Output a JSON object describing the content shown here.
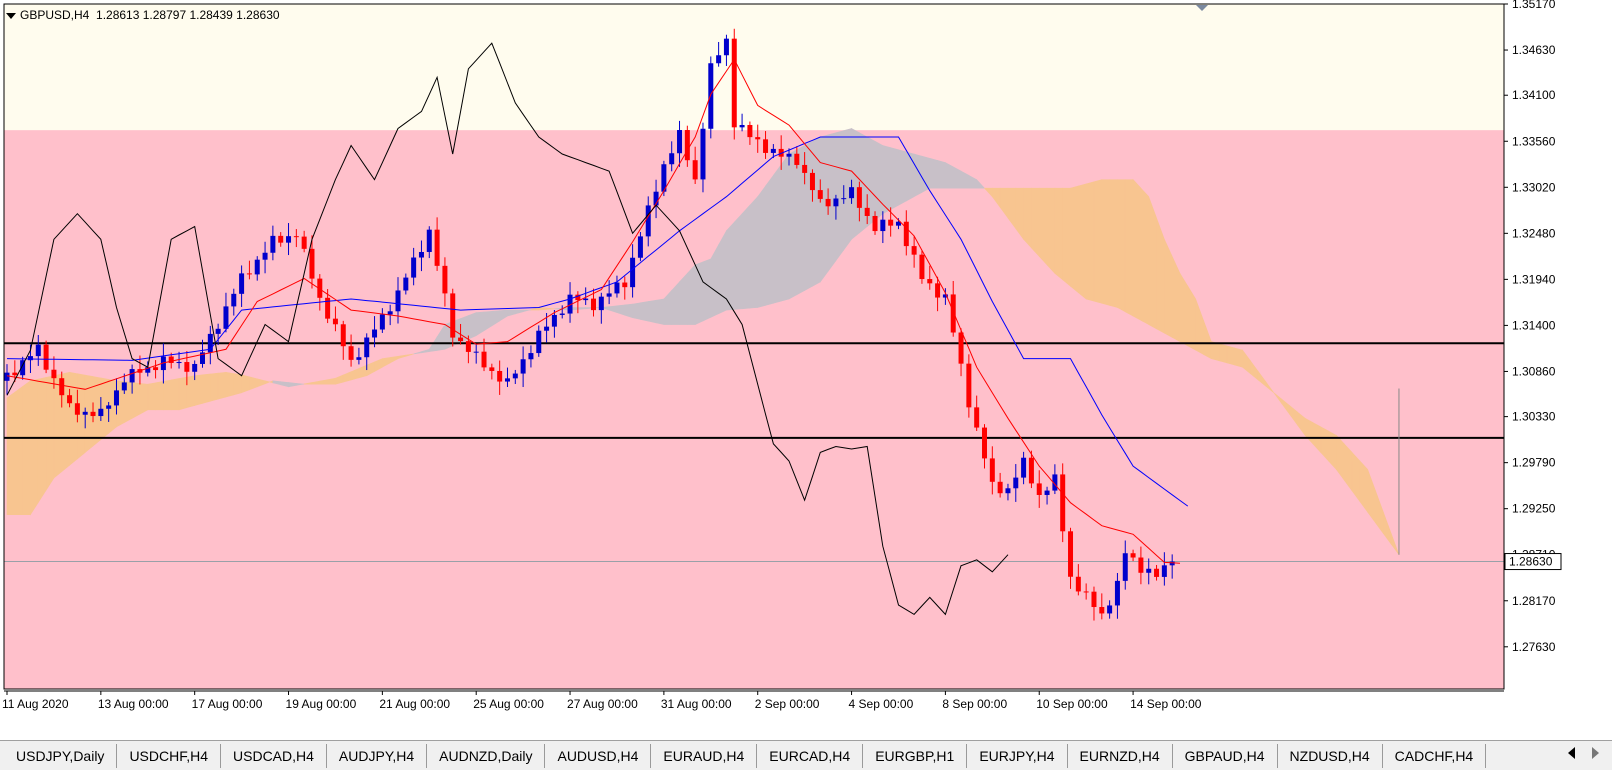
{
  "header": {
    "symbol": "GBPUSD,H4",
    "ohlc": "1.28613 1.28797 1.28439 1.28630"
  },
  "chart_data": {
    "type": "candlestick",
    "price_axis": [
      "1.35170",
      "1.34630",
      "1.34100",
      "1.33560",
      "1.33020",
      "1.32480",
      "1.31940",
      "1.31400",
      "1.30860",
      "1.30330",
      "1.29790",
      "1.29250",
      "1.28710",
      "1.28170",
      "1.27630"
    ],
    "current_price_label": "1.28630",
    "current_price": 1.2863,
    "time_axis": [
      {
        "label": "11 Aug 2020",
        "i": 0
      },
      {
        "label": "13 Aug 00:00",
        "i": 12
      },
      {
        "label": "17 Aug 00:00",
        "i": 24
      },
      {
        "label": "19 Aug 00:00",
        "i": 36
      },
      {
        "label": "21 Aug 00:00",
        "i": 48
      },
      {
        "label": "25 Aug 00:00",
        "i": 60
      },
      {
        "label": "27 Aug 00:00",
        "i": 72
      },
      {
        "label": "31 Aug 00:00",
        "i": 84
      },
      {
        "label": "2 Sep 00:00",
        "i": 96
      },
      {
        "label": "4 Sep 00:00",
        "i": 108
      },
      {
        "label": "8 Sep 00:00",
        "i": 120
      },
      {
        "label": "10 Sep 00:00",
        "i": 132
      },
      {
        "label": "14 Sep 00:00",
        "i": 144
      }
    ],
    "ylim": [
      1.27135,
      1.3517
    ],
    "pink_zone_top": 1.3369,
    "horizontal_lines": [
      1.3119,
      1.3008
    ],
    "vertical_line": {
      "i": 178,
      "from": 1.3066,
      "to": 1.2871
    },
    "colors": {
      "bull": "#0000cc",
      "bear": "#ff0000",
      "tenkan": "#ff0000",
      "kijun": "#0000ff",
      "chikou": "#000000",
      "cloud_bear": "#c8c0c8",
      "cloud_bull": "#f8c590",
      "background": "#fffcee",
      "zone": "#ffc0cb"
    },
    "anchors": {
      "close": [
        [
          0,
          1.3081
        ],
        [
          4,
          1.3112
        ],
        [
          8,
          1.3042
        ],
        [
          12,
          1.3035
        ],
        [
          15,
          1.3078
        ],
        [
          20,
          1.3098
        ],
        [
          24,
          1.3091
        ],
        [
          30,
          1.3195
        ],
        [
          34,
          1.3238
        ],
        [
          37,
          1.3248
        ],
        [
          40,
          1.3172
        ],
        [
          44,
          1.3098
        ],
        [
          46,
          1.3121
        ],
        [
          50,
          1.3178
        ],
        [
          54,
          1.3251
        ],
        [
          57,
          1.3131
        ],
        [
          60,
          1.3102
        ],
        [
          64,
          1.3071
        ],
        [
          68,
          1.3128
        ],
        [
          72,
          1.3172
        ],
        [
          75,
          1.3165
        ],
        [
          79,
          1.3191
        ],
        [
          84,
          1.3329
        ],
        [
          86,
          1.3362
        ],
        [
          88,
          1.3311
        ],
        [
          90,
          1.3441
        ],
        [
          92,
          1.3475
        ],
        [
          93,
          1.3379
        ],
        [
          95,
          1.3361
        ],
        [
          99,
          1.3338
        ],
        [
          101,
          1.3335
        ],
        [
          104,
          1.3282
        ],
        [
          108,
          1.3295
        ],
        [
          111,
          1.3255
        ],
        [
          114,
          1.3261
        ],
        [
          117,
          1.3195
        ],
        [
          120,
          1.3172
        ],
        [
          123,
          1.3051
        ],
        [
          126,
          1.2951
        ],
        [
          128,
          1.2948
        ],
        [
          130,
          1.2978
        ],
        [
          132,
          1.2941
        ],
        [
          134,
          1.2958
        ],
        [
          136,
          1.2845
        ],
        [
          138,
          1.2821
        ],
        [
          140,
          1.2801
        ],
        [
          142,
          1.2835
        ],
        [
          143,
          1.2873
        ],
        [
          145,
          1.2857
        ],
        [
          147,
          1.2845
        ],
        [
          149,
          1.2863
        ]
      ],
      "tenkan": [
        [
          0,
          1.3081
        ],
        [
          10,
          1.3065
        ],
        [
          20,
          1.3096
        ],
        [
          28,
          1.3112
        ],
        [
          32,
          1.3168
        ],
        [
          38,
          1.3195
        ],
        [
          44,
          1.3158
        ],
        [
          50,
          1.3151
        ],
        [
          56,
          1.3141
        ],
        [
          60,
          1.3118
        ],
        [
          64,
          1.3121
        ],
        [
          70,
          1.3155
        ],
        [
          76,
          1.3182
        ],
        [
          80,
          1.3238
        ],
        [
          84,
          1.3298
        ],
        [
          88,
          1.3361
        ],
        [
          90,
          1.3411
        ],
        [
          93,
          1.3452
        ],
        [
          96,
          1.3398
        ],
        [
          100,
          1.3375
        ],
        [
          104,
          1.3331
        ],
        [
          108,
          1.3321
        ],
        [
          112,
          1.3282
        ],
        [
          116,
          1.3245
        ],
        [
          120,
          1.3178
        ],
        [
          124,
          1.3091
        ],
        [
          128,
          1.3031
        ],
        [
          132,
          1.2975
        ],
        [
          136,
          1.2932
        ],
        [
          140,
          1.2905
        ],
        [
          144,
          1.2895
        ],
        [
          148,
          1.2862
        ],
        [
          150,
          1.2861
        ]
      ],
      "kijun": [
        [
          0,
          1.3101
        ],
        [
          16,
          1.3099
        ],
        [
          26,
          1.3112
        ],
        [
          30,
          1.3158
        ],
        [
          44,
          1.3171
        ],
        [
          58,
          1.3158
        ],
        [
          68,
          1.3161
        ],
        [
          72,
          1.3171
        ],
        [
          78,
          1.3191
        ],
        [
          86,
          1.3251
        ],
        [
          92,
          1.3291
        ],
        [
          98,
          1.3338
        ],
        [
          104,
          1.3361
        ],
        [
          114,
          1.3361
        ],
        [
          118,
          1.3298
        ],
        [
          122,
          1.3241
        ],
        [
          126,
          1.3168
        ],
        [
          130,
          1.3101
        ],
        [
          136,
          1.3101
        ],
        [
          140,
          1.3035
        ],
        [
          144,
          1.2975
        ],
        [
          148,
          1.2948
        ],
        [
          151,
          1.2928
        ]
      ],
      "chikou": [
        [
          0,
          1.3058
        ],
        [
          3,
          1.3111
        ],
        [
          6,
          1.3241
        ],
        [
          9,
          1.3271
        ],
        [
          12,
          1.3241
        ],
        [
          14,
          1.3161
        ],
        [
          16,
          1.3101
        ],
        [
          18,
          1.3091
        ],
        [
          21,
          1.3241
        ],
        [
          24,
          1.3256
        ],
        [
          27,
          1.3101
        ],
        [
          30,
          1.3081
        ],
        [
          33,
          1.3141
        ],
        [
          36,
          1.3121
        ],
        [
          39,
          1.3241
        ],
        [
          42,
          1.3311
        ],
        [
          44,
          1.3351
        ],
        [
          47,
          1.3311
        ],
        [
          50,
          1.3371
        ],
        [
          53,
          1.3391
        ],
        [
          55,
          1.3431
        ],
        [
          57,
          1.3341
        ],
        [
          59,
          1.3441
        ],
        [
          62,
          1.3471
        ],
        [
          65,
          1.3401
        ],
        [
          68,
          1.3361
        ],
        [
          71,
          1.3341
        ],
        [
          74,
          1.3331
        ],
        [
          77,
          1.3321
        ],
        [
          80,
          1.3248
        ],
        [
          83,
          1.3281
        ],
        [
          86,
          1.3251
        ],
        [
          89,
          1.3191
        ],
        [
          92,
          1.3171
        ],
        [
          94,
          1.3141
        ],
        [
          96,
          1.3071
        ],
        [
          98,
          1.3001
        ],
        [
          100,
          1.2981
        ],
        [
          102,
          1.2935
        ],
        [
          104,
          1.2991
        ],
        [
          106,
          1.2998
        ],
        [
          108,
          1.2995
        ],
        [
          110,
          1.2998
        ],
        [
          112,
          1.2881
        ],
        [
          114,
          1.2812
        ],
        [
          116,
          1.2801
        ],
        [
          118,
          1.2821
        ],
        [
          120,
          1.2801
        ],
        [
          122,
          1.2858
        ],
        [
          124,
          1.2865
        ],
        [
          126,
          1.2851
        ],
        [
          128,
          1.2871
        ]
      ],
      "span_a": [
        [
          0,
          1.3055
        ],
        [
          3,
          1.3075
        ],
        [
          8,
          1.3085
        ],
        [
          14,
          1.3075
        ],
        [
          18,
          1.3071
        ],
        [
          24,
          1.3081
        ],
        [
          28,
          1.3085
        ],
        [
          30,
          1.3082
        ],
        [
          36,
          1.3068
        ],
        [
          42,
          1.3078
        ],
        [
          48,
          1.3101
        ],
        [
          56,
          1.3112
        ],
        [
          60,
          1.3128
        ],
        [
          64,
          1.3151
        ],
        [
          68,
          1.3161
        ],
        [
          72,
          1.3158
        ],
        [
          76,
          1.3161
        ],
        [
          80,
          1.3149
        ],
        [
          84,
          1.3141
        ],
        [
          88,
          1.3141
        ],
        [
          92,
          1.3158
        ],
        [
          96,
          1.3161
        ],
        [
          100,
          1.3171
        ],
        [
          104,
          1.3191
        ],
        [
          108,
          1.3241
        ],
        [
          112,
          1.3271
        ],
        [
          116,
          1.3291
        ],
        [
          118,
          1.3301
        ],
        [
          120,
          1.3301
        ],
        [
          124,
          1.3301
        ],
        [
          128,
          1.3301
        ],
        [
          132,
          1.3301
        ],
        [
          136,
          1.3301
        ],
        [
          140,
          1.3311
        ],
        [
          144,
          1.3311
        ],
        [
          146,
          1.3291
        ],
        [
          148,
          1.3241
        ],
        [
          150,
          1.3201
        ],
        [
          152,
          1.3171
        ],
        [
          154,
          1.3121
        ],
        [
          158,
          1.3111
        ],
        [
          162,
          1.3061
        ],
        [
          166,
          1.3031
        ],
        [
          170,
          1.3011
        ],
        [
          174,
          1.2971
        ],
        [
          178,
          1.2871
        ]
      ],
      "span_b": [
        [
          0,
          1.2918
        ],
        [
          3,
          1.2918
        ],
        [
          6,
          1.2961
        ],
        [
          10,
          1.2991
        ],
        [
          14,
          1.3021
        ],
        [
          18,
          1.3041
        ],
        [
          22,
          1.3041
        ],
        [
          26,
          1.3051
        ],
        [
          30,
          1.3061
        ],
        [
          34,
          1.3075
        ],
        [
          38,
          1.3071
        ],
        [
          42,
          1.3071
        ],
        [
          46,
          1.3081
        ],
        [
          50,
          1.3101
        ],
        [
          54,
          1.3112
        ],
        [
          56,
          1.3141
        ],
        [
          60,
          1.3155
        ],
        [
          64,
          1.3158
        ],
        [
          68,
          1.3158
        ],
        [
          72,
          1.3161
        ],
        [
          76,
          1.3161
        ],
        [
          80,
          1.3165
        ],
        [
          84,
          1.3171
        ],
        [
          88,
          1.3211
        ],
        [
          90,
          1.3218
        ],
        [
          92,
          1.3251
        ],
        [
          96,
          1.3291
        ],
        [
          100,
          1.3341
        ],
        [
          104,
          1.3361
        ],
        [
          108,
          1.3371
        ],
        [
          112,
          1.3351
        ],
        [
          116,
          1.3341
        ],
        [
          120,
          1.3331
        ],
        [
          124,
          1.3311
        ],
        [
          126,
          1.3291
        ],
        [
          130,
          1.3241
        ],
        [
          134,
          1.3201
        ],
        [
          138,
          1.3171
        ],
        [
          142,
          1.3161
        ],
        [
          146,
          1.3141
        ],
        [
          150,
          1.3121
        ],
        [
          154,
          1.3101
        ],
        [
          158,
          1.3091
        ],
        [
          162,
          1.3061
        ],
        [
          166,
          1.3011
        ],
        [
          170,
          1.2971
        ],
        [
          174,
          1.2921
        ],
        [
          178,
          1.2871
        ]
      ]
    }
  },
  "tabs": [
    "USDJPY,Daily",
    "USDCHF,H4",
    "USDCAD,H4",
    "AUDJPY,H4",
    "AUDNZD,Daily",
    "AUDUSD,H4",
    "EURAUD,H4",
    "EURCAD,H4",
    "EURGBP,H1",
    "EURJPY,H4",
    "EURNZD,H4",
    "GBPAUD,H4",
    "NZDUSD,H4",
    "CADCHF,H4"
  ]
}
